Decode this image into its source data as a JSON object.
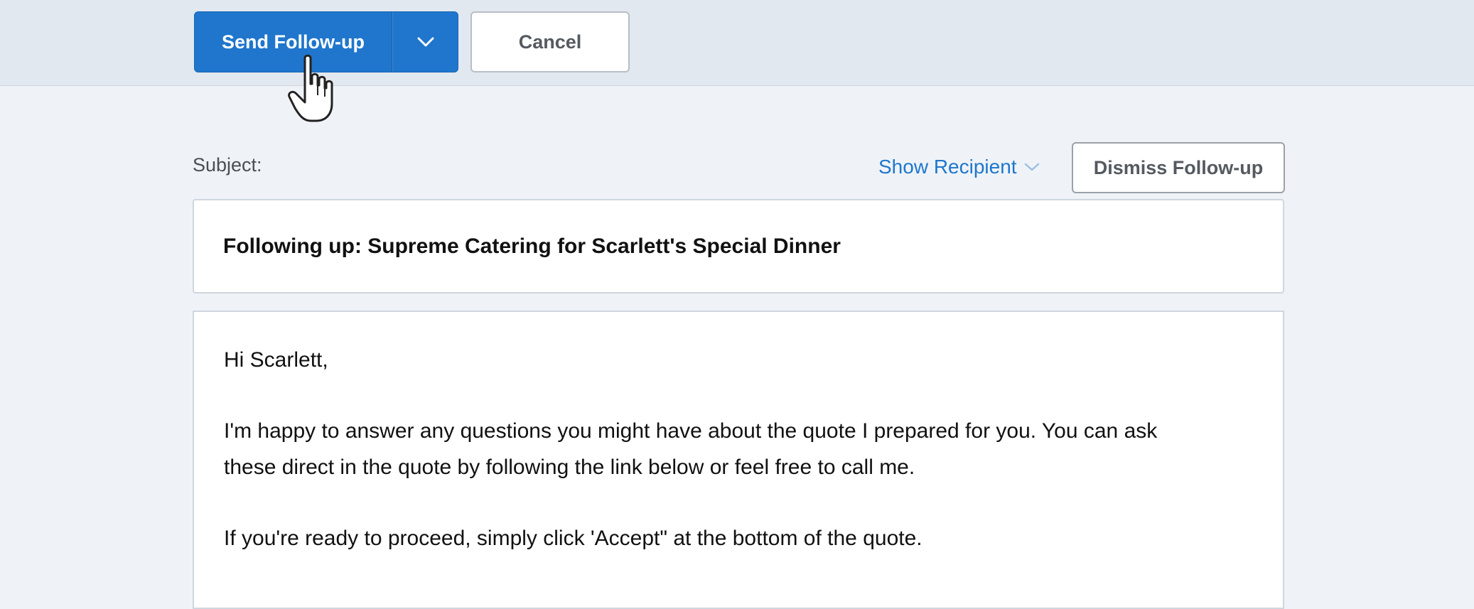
{
  "toolbar": {
    "send_label": "Send Follow-up",
    "cancel_label": "Cancel"
  },
  "subject": {
    "label": "Subject:",
    "value": "Following up: Supreme Catering for Scarlett's Special Dinner"
  },
  "header_actions": {
    "show_recipient_label": "Show Recipient",
    "dismiss_label": "Dismiss Follow-up"
  },
  "message": {
    "greeting": "Hi Scarlett,",
    "paragraph_1": "I'm happy to answer any questions you might have about the quote I prepared for you. You can ask these direct in the quote by following the link below or feel free to call me.",
    "paragraph_2": "If you're ready to proceed, simply click 'Accept\" at the bottom of the quote."
  },
  "colors": {
    "accent": "#1f76cc",
    "top_bar": "#e2e8f0",
    "background": "#eff3f7"
  },
  "icons": {
    "dropdown": "chevron-down-icon",
    "recipient_toggle": "chevron-down-icon",
    "cursor": "hand-pointer-icon"
  }
}
